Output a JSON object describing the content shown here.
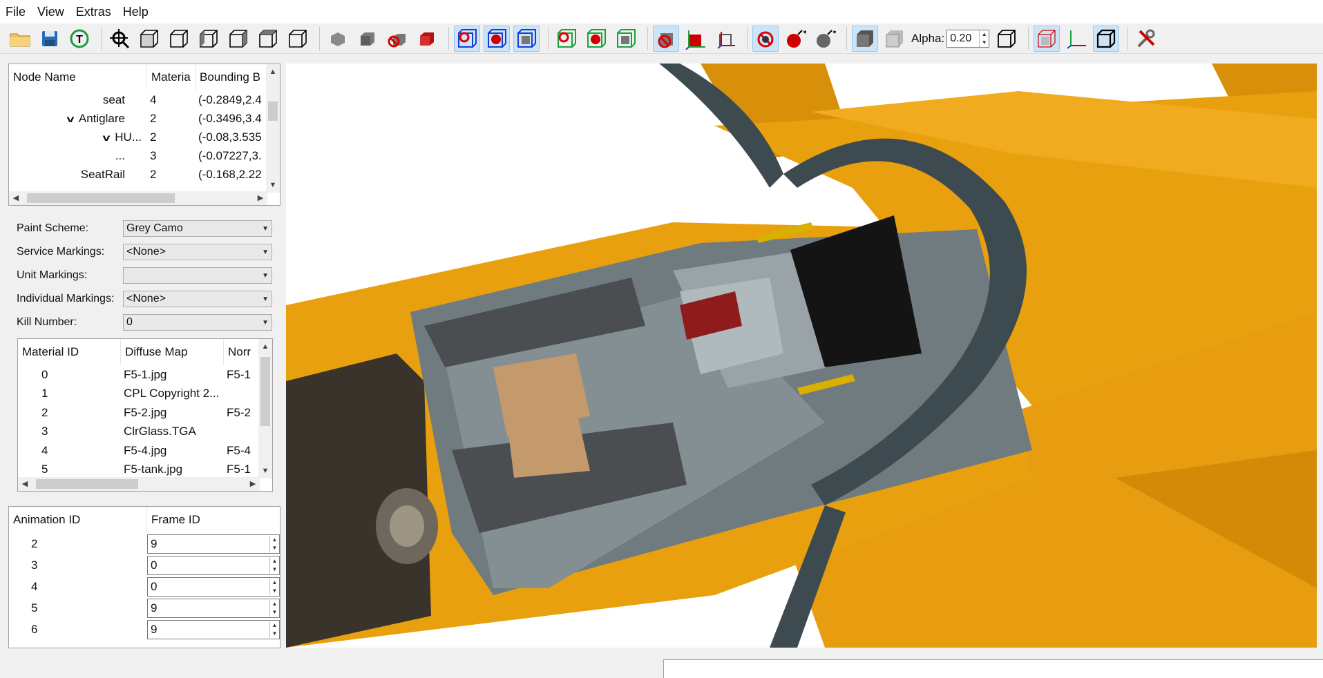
{
  "menu": [
    "File",
    "View",
    "Extras",
    "Help"
  ],
  "toolbar": {
    "alpha_label": "Alpha:",
    "alpha_value": "0.20",
    "buttons": [
      {
        "name": "open-folder-icon",
        "active": false
      },
      {
        "name": "save-disk-icon",
        "active": false
      },
      {
        "name": "texture-refresh-icon",
        "active": false
      },
      {
        "name": "zoom-target-icon",
        "active": false
      },
      {
        "name": "view-cube-front-icon",
        "active": false
      },
      {
        "name": "view-cube-back-icon",
        "active": false
      },
      {
        "name": "view-cube-left-icon",
        "active": false
      },
      {
        "name": "view-cube-right-icon",
        "active": false
      },
      {
        "name": "view-cube-top-icon",
        "active": false
      },
      {
        "name": "view-cube-bottom-icon",
        "active": false
      },
      {
        "name": "shade-hook-icon",
        "active": false
      },
      {
        "name": "shade-solid-icon",
        "active": false
      },
      {
        "name": "shade-red-no-icon",
        "active": false
      },
      {
        "name": "shade-red-cube-icon",
        "active": false
      },
      {
        "name": "blue-wire-no-icon",
        "active": true
      },
      {
        "name": "blue-wire-red-icon",
        "active": true
      },
      {
        "name": "blue-wire-grey-icon",
        "active": true
      },
      {
        "name": "green-wire-no-icon",
        "active": false
      },
      {
        "name": "green-wire-red-icon",
        "active": false
      },
      {
        "name": "green-wire-grey-icon",
        "active": false
      },
      {
        "name": "lights-off-icon",
        "active": true
      },
      {
        "name": "axis-red-icon",
        "active": false
      },
      {
        "name": "axis-box-icon",
        "active": false
      },
      {
        "name": "bomb-no-icon",
        "active": true
      },
      {
        "name": "bomb-red-icon",
        "active": false
      },
      {
        "name": "bomb-grey-icon",
        "active": false
      },
      {
        "name": "solid-box-icon",
        "active": true
      },
      {
        "name": "transparent-box-icon",
        "active": false
      }
    ],
    "after_alpha_buttons": [
      {
        "name": "wire-box-icon",
        "active": false
      },
      {
        "name": "bounding-box-icon",
        "active": true
      },
      {
        "name": "axes-icon",
        "active": false
      },
      {
        "name": "outline-box-icon",
        "active": true
      },
      {
        "name": "tools-icon",
        "active": false
      }
    ]
  },
  "node_tree": {
    "headers": [
      "Node Name",
      "Materia",
      "Bounding B"
    ],
    "rows": [
      {
        "name": "seat",
        "expand": "",
        "material": "4",
        "bounds": "(-0.2849,2.4"
      },
      {
        "name": "Antiglare",
        "expand": "v",
        "material": "2",
        "bounds": "(-0.3496,3.4"
      },
      {
        "name": "HU...",
        "expand": "v",
        "material": "2",
        "bounds": "(-0.08,3.535"
      },
      {
        "name": "...",
        "expand": "",
        "material": "3",
        "bounds": "(-0.07227,3."
      },
      {
        "name": "SeatRail",
        "expand": "",
        "material": "2",
        "bounds": "(-0.168,2.22"
      }
    ]
  },
  "form": {
    "paint_scheme": {
      "label": "Paint Scheme:",
      "value": "Grey Camo"
    },
    "service_markings": {
      "label": "Service Markings:",
      "value": "<None>"
    },
    "unit_markings": {
      "label": "Unit Markings:",
      "value": ""
    },
    "individual_markings": {
      "label": "Individual Markings:",
      "value": "<None>"
    },
    "kill_number": {
      "label": "Kill Number:",
      "value": "0"
    }
  },
  "materials": {
    "headers": [
      "Material ID",
      "Diffuse Map",
      "Norr"
    ],
    "rows": [
      {
        "id": "0",
        "diffuse": "F5-1.jpg",
        "normal": "F5-1-"
      },
      {
        "id": "1",
        "diffuse": "CPL Copyright 2...",
        "normal": ""
      },
      {
        "id": "2",
        "diffuse": "F5-2.jpg",
        "normal": "F5-2-"
      },
      {
        "id": "3",
        "diffuse": "ClrGlass.TGA",
        "normal": ""
      },
      {
        "id": "4",
        "diffuse": "F5-4.jpg",
        "normal": "F5-4-"
      },
      {
        "id": "5",
        "diffuse": "F5-tank.jpg",
        "normal": "F5-1-"
      }
    ]
  },
  "animations": {
    "headers": [
      "Animation ID",
      "Frame ID"
    ],
    "rows": [
      {
        "id": "2",
        "frame": "9"
      },
      {
        "id": "3",
        "frame": "0"
      },
      {
        "id": "4",
        "frame": "0"
      },
      {
        "id": "5",
        "frame": "9"
      },
      {
        "id": "6",
        "frame": "9"
      }
    ]
  },
  "colors": {
    "fuselage": "#e8a00e",
    "canopy_frame": "#3d4a4f",
    "accent_active": "#cce4f7"
  }
}
